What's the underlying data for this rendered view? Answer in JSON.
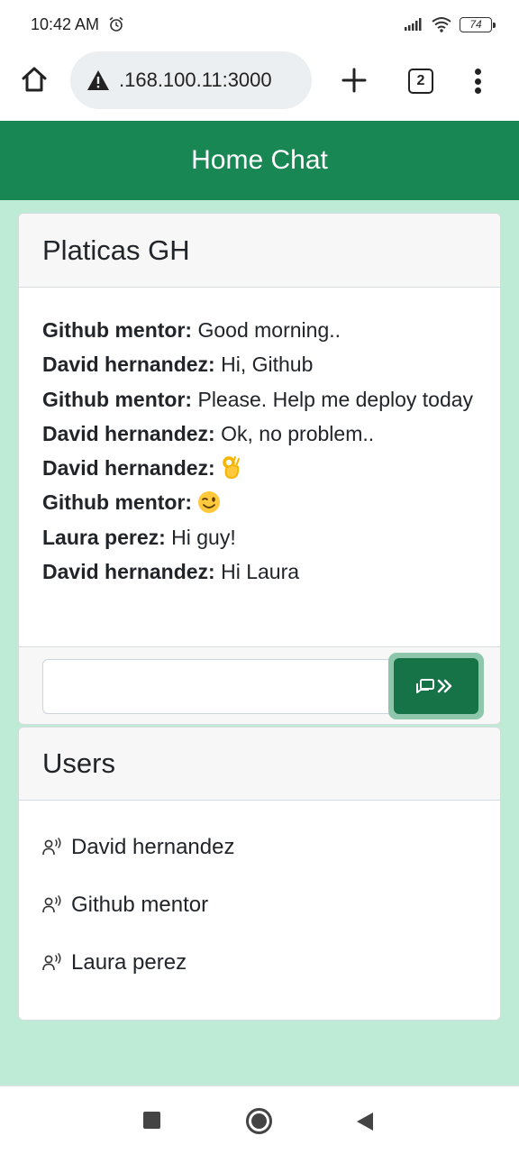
{
  "status_bar": {
    "time": "10:42 AM",
    "battery": "74"
  },
  "browser": {
    "url": ".168.100.11:3000",
    "tab_count": "2"
  },
  "app": {
    "title": "Home Chat"
  },
  "chat": {
    "title": "Platicas GH",
    "messages": [
      {
        "author": "Github mentor:",
        "text": "Good morning.."
      },
      {
        "author": "David hernandez:",
        "text": "Hi, Github"
      },
      {
        "author": "Github mentor:",
        "text": "Please. Help me deploy today"
      },
      {
        "author": "David hernandez:",
        "text": "Ok, no problem.."
      },
      {
        "author": "David hernandez:",
        "text": "",
        "emoji": "ok-hand-emoji"
      },
      {
        "author": "Github mentor:",
        "text": "",
        "emoji": "winking-face-emoji"
      },
      {
        "author": "Laura perez:",
        "text": "Hi guy!"
      },
      {
        "author": "David hernandez:",
        "text": "Hi Laura"
      }
    ],
    "input_value": "",
    "send_icon": "chat-send-icon"
  },
  "users": {
    "title": "Users",
    "items": [
      {
        "name": "David hernandez",
        "icon": "person-voice-icon"
      },
      {
        "name": "Github mentor",
        "icon": "person-voice-icon"
      },
      {
        "name": "Laura perez",
        "icon": "person-voice-icon"
      }
    ]
  },
  "colors": {
    "primary": "#198754",
    "background": "#bdebd6"
  }
}
